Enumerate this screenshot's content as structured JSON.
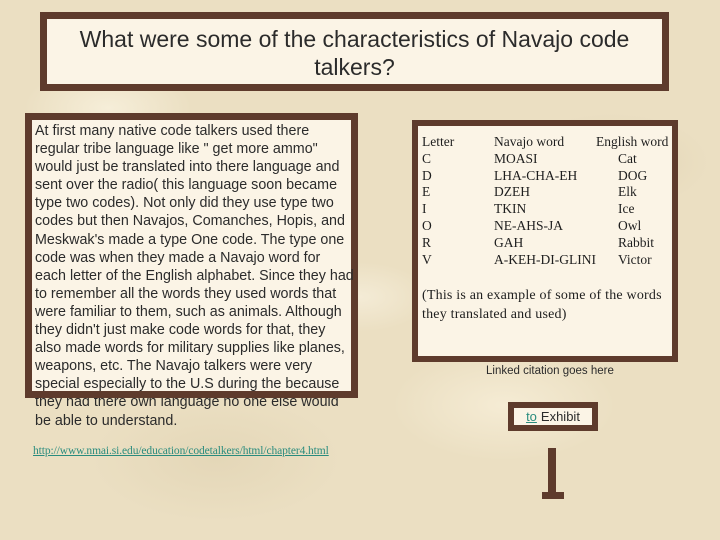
{
  "title": "What were some of the characteristics of Navajo code talkers?",
  "body_text": "At first many native code talkers used there regular tribe language like \" get more ammo\" would just be translated into there language and sent over the radio( this language soon became type two codes). Not only did they use type two codes but then Navajos, Comanches, Hopis, and Meskwak's made a type One code. The type one code was when they made a Navajo word for each letter of the English alphabet. Since they had to remember all the words they used words that were familiar to them, such as animals. Although they didn't just make code words for that, they also made words for military supplies like planes, weapons, etc. The  Navajo talkers were very special especially to the U.S during the because they had there own language no one else would be able to understand.",
  "source_url": "http://www.nmai.si.edu/education/codetalkers/html/chapter4.html",
  "code_table": {
    "headers": [
      "Letter",
      "Navajo word",
      "English word"
    ],
    "rows": [
      [
        "C",
        "MOASI",
        "Cat"
      ],
      [
        "D",
        "LHA-CHA-EH",
        "DOG"
      ],
      [
        "E",
        "DZEH",
        "Elk"
      ],
      [
        "I",
        "TKIN",
        "Ice"
      ],
      [
        "O",
        "NE-AHS-JA",
        "Owl"
      ],
      [
        "R",
        "GAH",
        "Rabbit"
      ],
      [
        "V",
        "A-KEH-DI-GLINI",
        "Victor"
      ]
    ]
  },
  "example_note": "(This is an example of some of the words they translated and used)",
  "citation_text": "Linked citation goes here",
  "exhibit": {
    "link_label": "to",
    "label": "Exhibit"
  },
  "colors": {
    "border": "#5e3b2c",
    "panel": "#fbf4e6",
    "link": "#2a8c7e"
  }
}
